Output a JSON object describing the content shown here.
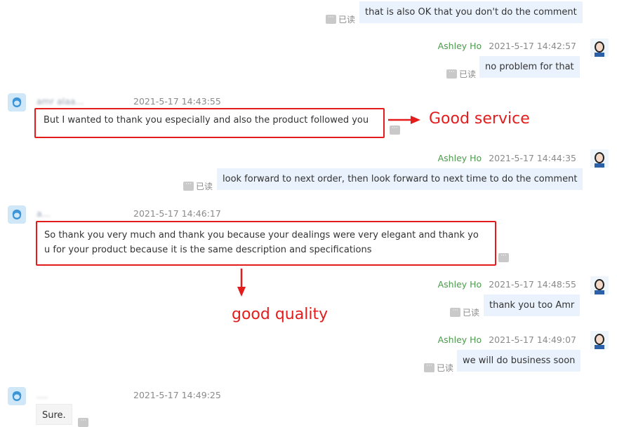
{
  "labels": {
    "read": "已读",
    "more": "···"
  },
  "messages": [
    {
      "id": "m1",
      "side": "right",
      "text": "that is also OK that you don't do the comment"
    },
    {
      "id": "m2",
      "side": "right",
      "sender": "Ashley Ho",
      "time": "2021-5-17 14:42:57",
      "text": "no problem for that"
    },
    {
      "id": "m3",
      "side": "left",
      "sender_blurred": "amr alaa...",
      "time": "2021-5-17 14:43:55",
      "text": "But I wanted to thank you especially and also the product followed you"
    },
    {
      "id": "m4",
      "side": "right",
      "sender": "Ashley Ho",
      "time": "2021-5-17 14:44:35",
      "text": "look forward to next order, then look forward to next time to do the comment"
    },
    {
      "id": "m5",
      "side": "left",
      "sender_blurred": "a...",
      "time": "2021-5-17 14:46:17",
      "text_line1": "So thank you very much and thank you because your dealings were very elegant and thank yo",
      "text_line2": "u for your product because it is the same description and specifications"
    },
    {
      "id": "m6",
      "side": "right",
      "sender": "Ashley Ho",
      "time": "2021-5-17 14:48:55",
      "text": "thank you too Amr"
    },
    {
      "id": "m7",
      "side": "right",
      "sender": "Ashley Ho",
      "time": "2021-5-17 14:49:07",
      "text": "we will do business soon"
    },
    {
      "id": "m8",
      "side": "left",
      "sender_blurred": "....",
      "time": "2021-5-17 14:49:25",
      "text": "Sure."
    }
  ],
  "annotations": {
    "service": "Good service",
    "quality": "good quality"
  },
  "colors": {
    "annotation_red": "#e51c1c",
    "sender_green": "#4b9a4b",
    "bubble_blue": "#e9f2fd"
  }
}
